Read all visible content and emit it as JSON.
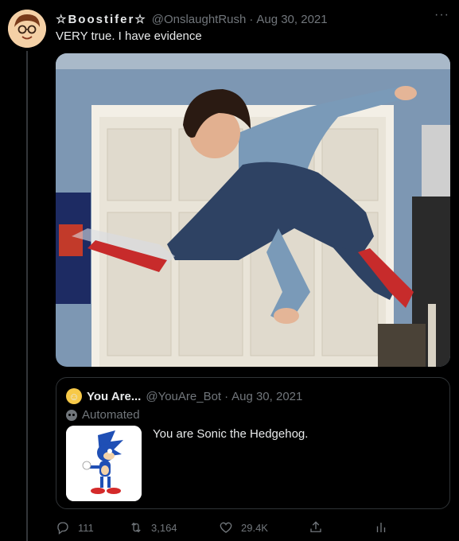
{
  "tweet": {
    "display_name": "☆Boostifer☆",
    "handle": "@OnslaughtRush",
    "separator": "·",
    "date": "Aug 30, 2021",
    "more": "···",
    "text": "VERY true. I have evidence"
  },
  "quote": {
    "display_name": "You Are...",
    "handle": "@YouAre_Bot",
    "separator": "·",
    "date": "Aug 30, 2021",
    "automated_label": "Automated",
    "text": "You are Sonic the Hedgehog."
  },
  "actions": {
    "replies": "111",
    "retweets": "3,164",
    "likes": "29.4K"
  },
  "icons": [
    "reply-icon",
    "retweet-icon",
    "like-icon",
    "share-icon",
    "analytics-icon",
    "more-icon"
  ],
  "colors": {
    "background": "#000000",
    "text": "#e7e9ea",
    "muted": "#71767b",
    "border": "#2f3336"
  }
}
